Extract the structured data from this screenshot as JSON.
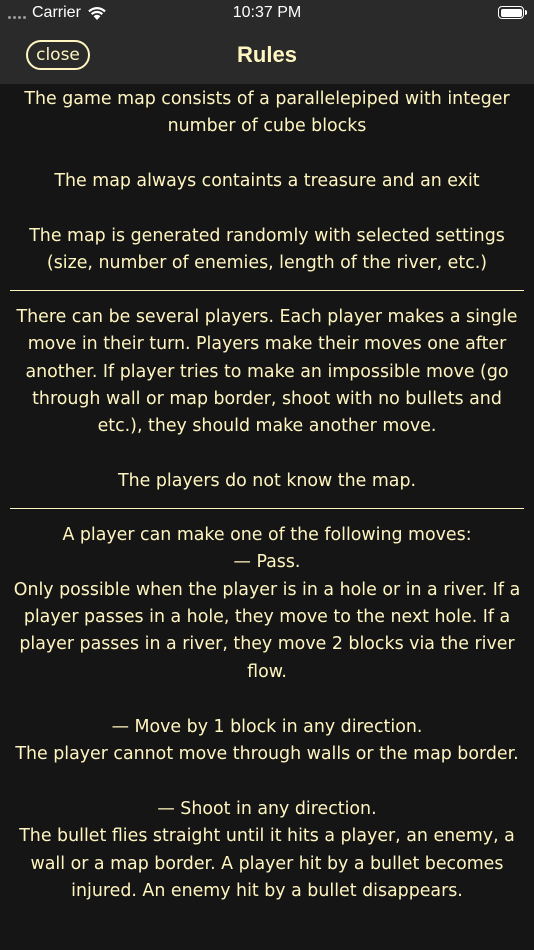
{
  "status_bar": {
    "carrier": "Carrier",
    "time": "10:37 PM"
  },
  "nav": {
    "close_label": "close",
    "title": "Rules"
  },
  "sections": [
    {
      "paragraphs": [
        "The game map consists of a parallelepiped with integer number of cube blocks",
        "",
        "The map always containts a treasure and an exit",
        "",
        "The map is generated randomly with selected settings (size, number of enemies, length of the river, etc.)"
      ]
    },
    {
      "paragraphs": [
        "There can be several players. Each player makes a single move in their turn. Players make their moves one after another. If player tries to make an impossible move (go through wall or map border, shoot with no bullets and etc.), they should make another move.",
        "",
        "The players do not know the map."
      ]
    },
    {
      "paragraphs": [
        "A player can make one of the following moves:",
        "— Pass.",
        "Only possible when the player is in a hole or in a river. If a player passes in a hole, they move to the next hole. If a player passes in a river, they move 2 blocks via the river flow.",
        "",
        "— Move by 1 block in any direction.",
        "The player cannot move through walls or the map border.",
        "",
        "— Shoot in any direction.",
        "The bullet flies straight until it hits a player, an enemy, a wall or a map border. A player hit by a bullet becomes injured. An enemy hit by a bullet disappears."
      ]
    }
  ]
}
